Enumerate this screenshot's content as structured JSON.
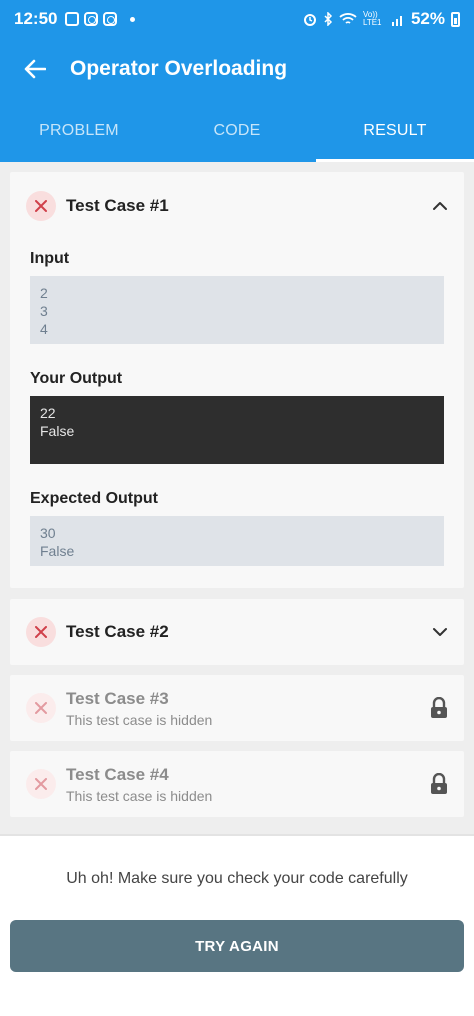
{
  "status_bar": {
    "time": "12:50",
    "battery": "52%",
    "network_label": "Vo)) LTE1"
  },
  "header": {
    "title": "Operator Overloading"
  },
  "tabs": [
    {
      "label": "PROBLEM",
      "active": false
    },
    {
      "label": "CODE",
      "active": false
    },
    {
      "label": "RESULT",
      "active": true
    }
  ],
  "test_cases": [
    {
      "title": "Test Case #1",
      "status": "failed",
      "expanded": true,
      "input_label": "Input",
      "input": "2\n3\n4",
      "your_output_label": "Your Output",
      "your_output": "22\nFalse",
      "expected_output_label": "Expected Output",
      "expected_output": "30\nFalse"
    },
    {
      "title": "Test Case #2",
      "status": "failed",
      "expanded": false
    },
    {
      "title": "Test Case #3",
      "status": "failed",
      "hidden": true,
      "subtitle": "This test case is hidden"
    },
    {
      "title": "Test Case #4",
      "status": "failed",
      "hidden": true,
      "subtitle": "This test case is hidden"
    }
  ],
  "footer": {
    "message": "Uh oh! Make sure you check your code carefully",
    "button_label": "TRY AGAIN"
  },
  "colors": {
    "primary": "#1f96e8",
    "fail": "#d0404a",
    "button": "#587582",
    "dark_output": "#2e2e2e"
  },
  "icons": [
    "back-arrow-icon",
    "close-icon",
    "chevron-up-icon",
    "chevron-down-icon",
    "lock-icon"
  ]
}
